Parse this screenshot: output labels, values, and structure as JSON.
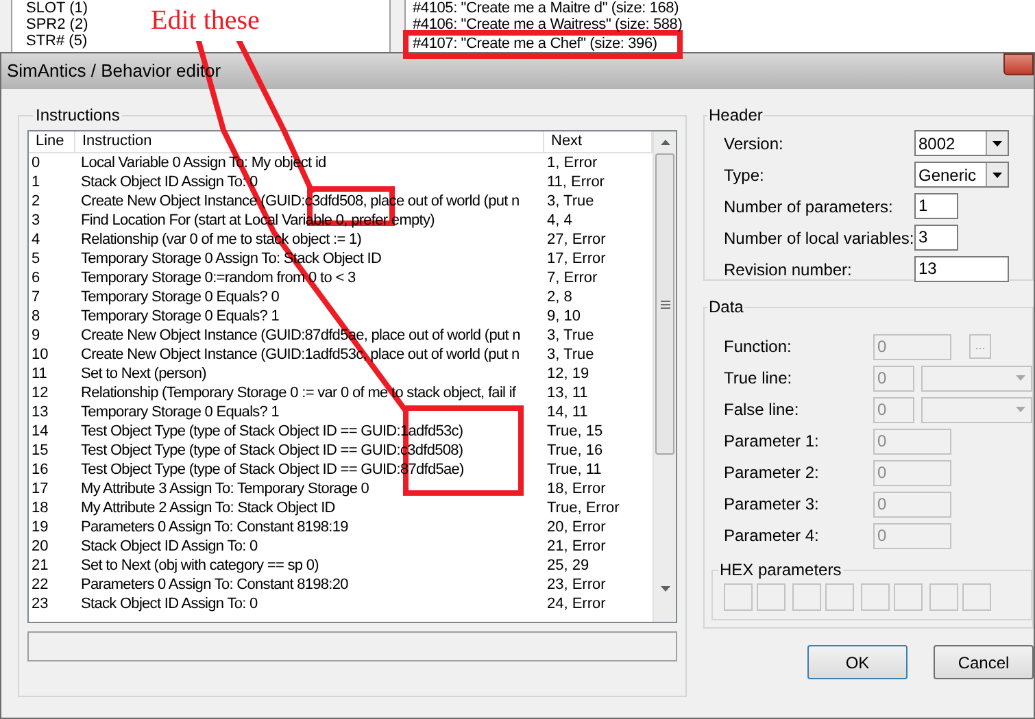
{
  "background_window": {
    "resource_list": [
      "SLOT (1)",
      "SPR2 (2)",
      "STR# (5)"
    ],
    "behavior_list": [
      {
        "text": "#4105: \"Create me a Maitre d\" (size: 168)",
        "selected": false
      },
      {
        "text": "#4106: \"Create me a Waitress\" (size: 588)",
        "selected": false
      },
      {
        "text": "#4107: \"Create me a Chef\" (size: 396)",
        "selected": false
      }
    ]
  },
  "annotation": {
    "text": "Edit these"
  },
  "dialog": {
    "title": "SimAntics / Behavior editor",
    "instructions": {
      "title": "Instructions",
      "columns": [
        "Line",
        "Instruction",
        "Next"
      ],
      "rows": [
        {
          "line": "0",
          "instruction": "Local Variable 0 Assign To: My object id",
          "next": "1, Error"
        },
        {
          "line": "1",
          "instruction": "Stack Object ID Assign To: 0",
          "next": "11, Error"
        },
        {
          "line": "2",
          "instruction": "Create New Object Instance (GUID:c3dfd508, place out of world (put n",
          "next": "3, True"
        },
        {
          "line": "3",
          "instruction": "Find Location For (start at Local Variable 0, prefer empty)",
          "next": "4, 4"
        },
        {
          "line": "4",
          "instruction": "Relationship (var 0 of me to stack object := 1)",
          "next": "27, Error"
        },
        {
          "line": "5",
          "instruction": "Temporary Storage 0 Assign To: Stack Object ID",
          "next": "17, Error"
        },
        {
          "line": "6",
          "instruction": "Temporary Storage 0:=random from 0 to < 3",
          "next": "7, Error"
        },
        {
          "line": "7",
          "instruction": "Temporary Storage 0 Equals? 0",
          "next": "2, 8"
        },
        {
          "line": "8",
          "instruction": "Temporary Storage 0 Equals? 1",
          "next": "9, 10"
        },
        {
          "line": "9",
          "instruction": "Create New Object Instance (GUID:87dfd5ae, place out of world (put n",
          "next": "3, True"
        },
        {
          "line": "10",
          "instruction": "Create New Object Instance (GUID:1adfd53c, place out of world (put n",
          "next": "3, True"
        },
        {
          "line": "11",
          "instruction": "Set to Next (person)",
          "next": "12, 19"
        },
        {
          "line": "12",
          "instruction": "Relationship (Temporary Storage 0 := var 0 of me to stack object, fail if",
          "next": "13, 11"
        },
        {
          "line": "13",
          "instruction": "Temporary Storage 0 Equals? 1",
          "next": "14, 11"
        },
        {
          "line": "14",
          "instruction": "Test Object Type (type of Stack Object ID == GUID:1adfd53c)",
          "next": "True, 15"
        },
        {
          "line": "15",
          "instruction": "Test Object Type (type of Stack Object ID == GUID:c3dfd508)",
          "next": "True, 16"
        },
        {
          "line": "16",
          "instruction": "Test Object Type (type of Stack Object ID == GUID:87dfd5ae)",
          "next": "True, 11"
        },
        {
          "line": "17",
          "instruction": "My Attribute 3 Assign To: Temporary Storage 0",
          "next": "18, Error"
        },
        {
          "line": "18",
          "instruction": "My Attribute 2 Assign To: Stack Object ID",
          "next": "True, Error"
        },
        {
          "line": "19",
          "instruction": "Parameters 0 Assign To: Constant 8198:19",
          "next": "20, Error"
        },
        {
          "line": "20",
          "instruction": "Stack Object ID Assign To: 0",
          "next": "21, Error"
        },
        {
          "line": "21",
          "instruction": "Set to Next (obj with category == sp 0)",
          "next": "25, 29"
        },
        {
          "line": "22",
          "instruction": "Parameters 0 Assign To: Constant 8198:20",
          "next": "23, Error"
        },
        {
          "line": "23",
          "instruction": "Stack Object ID Assign To: 0",
          "next": "24, Error"
        }
      ]
    },
    "header": {
      "title": "Header",
      "fields": [
        {
          "label": "Version:",
          "kind": "dropdown",
          "value": "8002"
        },
        {
          "label": "Type:",
          "kind": "dropdown",
          "value": "Generic"
        },
        {
          "label": "Number of parameters:",
          "kind": "short",
          "value": "1"
        },
        {
          "label": "Number of local variables:",
          "kind": "short",
          "value": "3"
        },
        {
          "label": "Revision number:",
          "kind": "wide",
          "value": "13"
        }
      ]
    },
    "data": {
      "title": "Data",
      "disabled": true,
      "fields": [
        {
          "label": "Function:",
          "kind": "browse",
          "value": "0",
          "button": "..."
        },
        {
          "label": "True line:",
          "kind": "line",
          "value": "0"
        },
        {
          "label": "False line:",
          "kind": "line",
          "value": "0"
        },
        {
          "label": "Parameter 1:",
          "kind": "text",
          "value": "0"
        },
        {
          "label": "Parameter 2:",
          "kind": "text",
          "value": "0"
        },
        {
          "label": "Parameter 3:",
          "kind": "text",
          "value": "0"
        },
        {
          "label": "Parameter 4:",
          "kind": "text",
          "value": "0"
        }
      ],
      "hex_title": "HEX parameters"
    },
    "buttons": [
      "OK",
      "Cancel"
    ]
  }
}
